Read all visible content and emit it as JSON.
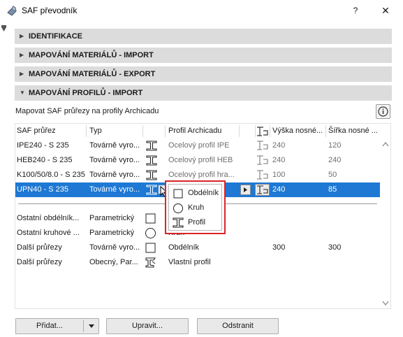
{
  "window": {
    "title": "SAF převodník",
    "help_label": "?",
    "close_label": "✕"
  },
  "sections": [
    {
      "label": "IDENTIFIKACE",
      "expanded": false
    },
    {
      "label": "MAPOVÁNÍ MATERIÁLŮ - IMPORT",
      "expanded": false
    },
    {
      "label": "MAPOVÁNÍ MATERIÁLŮ - EXPORT",
      "expanded": false
    },
    {
      "label": "MAPOVÁNÍ PROFILŮ - IMPORT",
      "expanded": true
    }
  ],
  "profile_mapping": {
    "subtitle": "Mapovat SAF průřezy na profily Archicadu",
    "columns": {
      "saf": "SAF průřez",
      "type": "Typ",
      "archicad": "Profil Archicadu",
      "height": "Výška nosné...",
      "width": "Šířka nosné ..."
    },
    "rows": [
      {
        "saf": "IPE240 - S 235",
        "type": "Továrně vyro...",
        "icon": "i-beam-icon",
        "archicad": "Ocelový profil IPE",
        "height": "240",
        "width": "120",
        "muted": true,
        "selected": false
      },
      {
        "saf": "HEB240 - S 235",
        "type": "Továrně vyro...",
        "icon": "i-beam-icon",
        "archicad": "Ocelový profil HEB",
        "height": "240",
        "width": "240",
        "muted": true,
        "selected": false
      },
      {
        "saf": "K100/50/8.0 - S 235",
        "type": "Továrně vyro...",
        "icon": "i-beam-icon",
        "archicad": "Ocelový profil hra...",
        "height": "100",
        "width": "50",
        "muted": true,
        "selected": false
      },
      {
        "saf": "UPN40 - S 235",
        "type": "Továrně vyro...",
        "icon": "i-beam-icon",
        "archicad": "",
        "height": "240",
        "width": "85",
        "muted": false,
        "selected": true
      }
    ],
    "other_rows": [
      {
        "saf": "Ostatní obdélník...",
        "type": "Parametrický",
        "icon": "rectangle-icon",
        "archicad": "",
        "height": "",
        "width": ""
      },
      {
        "saf": "Ostatní kruhové ...",
        "type": "Parametrický",
        "icon": "circle-icon",
        "archicad": "Kruh",
        "height": "",
        "width": ""
      },
      {
        "saf": "Další průřezy",
        "type": "Továrně vyro...",
        "icon": "rectangle-icon",
        "archicad": "Obdélník",
        "height": "300",
        "width": "300"
      },
      {
        "saf": "Další průřezy",
        "type": "Obecný, Par...",
        "icon": "custom-profile-icon",
        "archicad": "Vlastní profil",
        "height": "",
        "width": ""
      }
    ],
    "dropdown_options": [
      {
        "label": "Obdélník",
        "icon": "rectangle-icon"
      },
      {
        "label": "Kruh",
        "icon": "circle-icon"
      },
      {
        "label": "Profil",
        "icon": "i-beam-icon"
      }
    ]
  },
  "buttons": {
    "add": "Přidat...",
    "edit": "Upravit...",
    "remove": "Odstranit"
  },
  "colors": {
    "selection": "#1e78d4",
    "highlight_border": "#d9252a",
    "section_bg": "#dcdcdc"
  }
}
